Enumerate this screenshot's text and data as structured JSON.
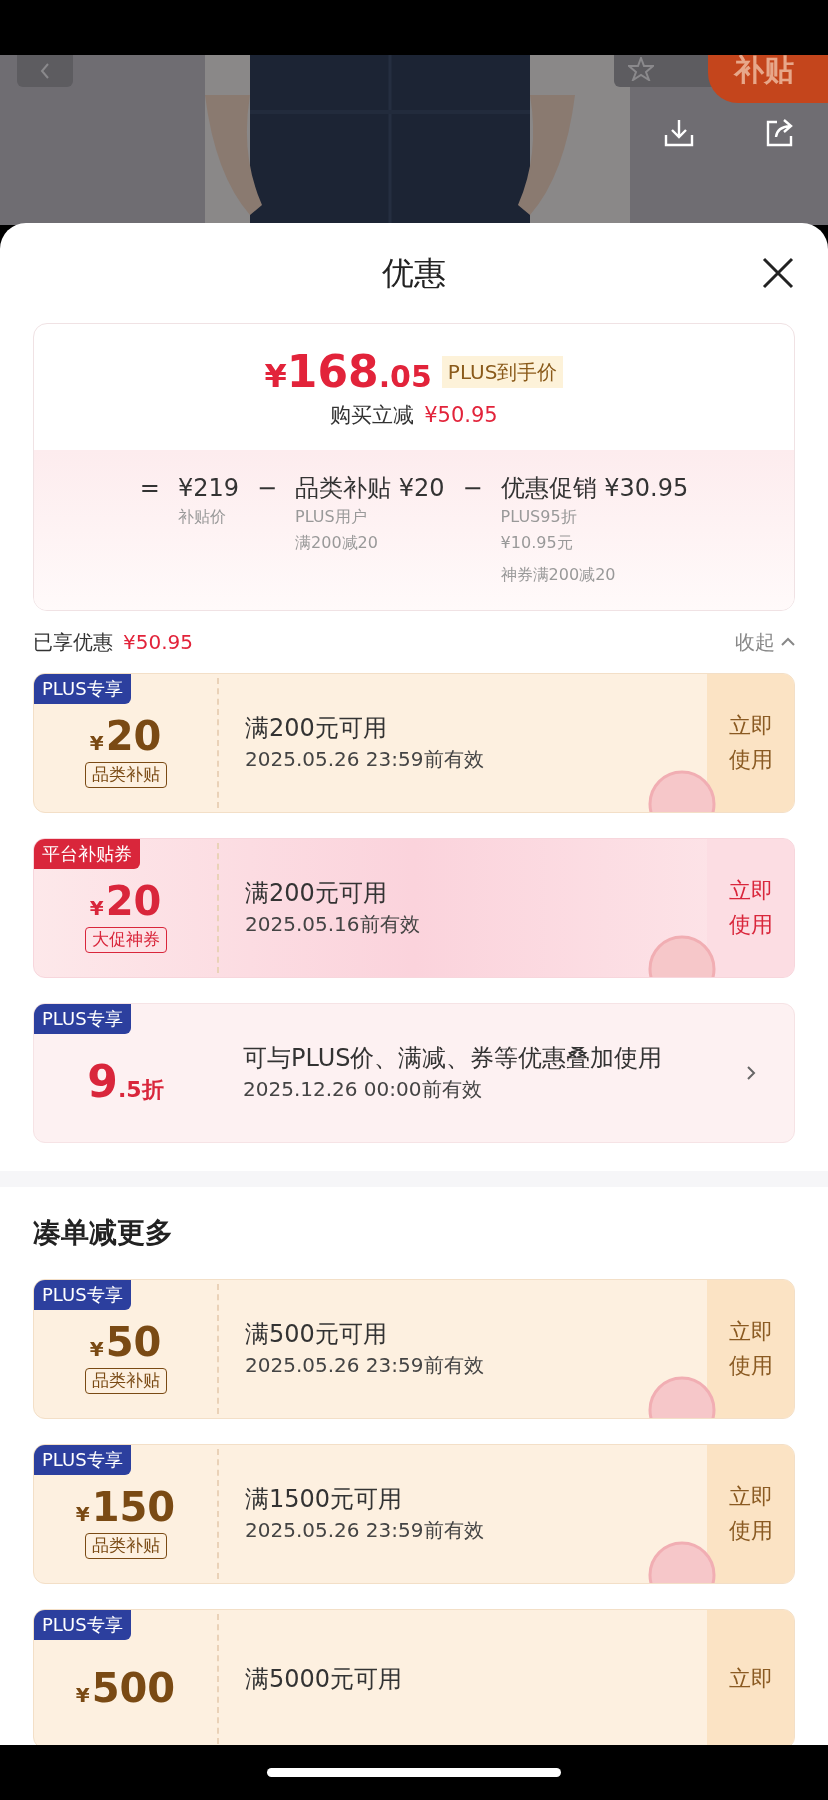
{
  "header": {
    "badge": "补贴"
  },
  "sheet": {
    "title": "优惠"
  },
  "price": {
    "currency": "¥",
    "integer": "168",
    "decimal": ".05",
    "tag": "PLUS到手价",
    "saving_label": "购买立减",
    "saving_value": "¥50.95",
    "terms": [
      {
        "op": "=",
        "value": "¥219",
        "notes": [
          "补贴价"
        ]
      },
      {
        "op": "−",
        "value": "品类补贴 ¥20",
        "notes": [
          "PLUS用户",
          "满200减20"
        ]
      },
      {
        "op": "−",
        "value": "优惠促销 ¥30.95",
        "notes": [
          "PLUS95折",
          "¥10.95元",
          "神券满200减20"
        ]
      }
    ]
  },
  "enjoyed": {
    "label": "已享优惠",
    "value": "¥50.95",
    "toggle": "收起",
    "expanded": true
  },
  "coupons": [
    {
      "kind": "plus",
      "tag": "PLUS专享",
      "currency": "¥",
      "amount": "20",
      "label": "品类补贴",
      "condition": "满200元可用",
      "validity": "2025.05.26 23:59前有效",
      "action": [
        "立即",
        "使用"
      ],
      "claimed": true
    },
    {
      "kind": "platform",
      "tag": "平台补贴券",
      "currency": "¥",
      "amount": "20",
      "label": "大促神券",
      "condition": "满200元可用",
      "validity": "2025.05.16前有效",
      "action": [
        "立即",
        "使用"
      ],
      "claimed": true
    },
    {
      "kind": "discount",
      "tag": "PLUS专享",
      "amount": "9",
      "suffix": ".5折",
      "condition": "可与PLUS价、满减、券等优惠叠加使用",
      "validity": "2025.12.26 00:00前有效"
    }
  ],
  "more": {
    "title": "凑单减更多",
    "coupons": [
      {
        "kind": "plus",
        "tag": "PLUS专享",
        "currency": "¥",
        "amount": "50",
        "label": "品类补贴",
        "condition": "满500元可用",
        "validity": "2025.05.26 23:59前有效",
        "action": [
          "立即",
          "使用"
        ],
        "claimed": true
      },
      {
        "kind": "plus",
        "tag": "PLUS专享",
        "currency": "¥",
        "amount": "150",
        "label": "品类补贴",
        "condition": "满1500元可用",
        "validity": "2025.05.26 23:59前有效",
        "action": [
          "立即",
          "使用"
        ],
        "claimed": true
      },
      {
        "kind": "plus",
        "tag": "PLUS专享",
        "currency": "¥",
        "amount": "500",
        "condition": "满5000元可用",
        "action": [
          "立即"
        ],
        "claimed": false
      }
    ]
  }
}
